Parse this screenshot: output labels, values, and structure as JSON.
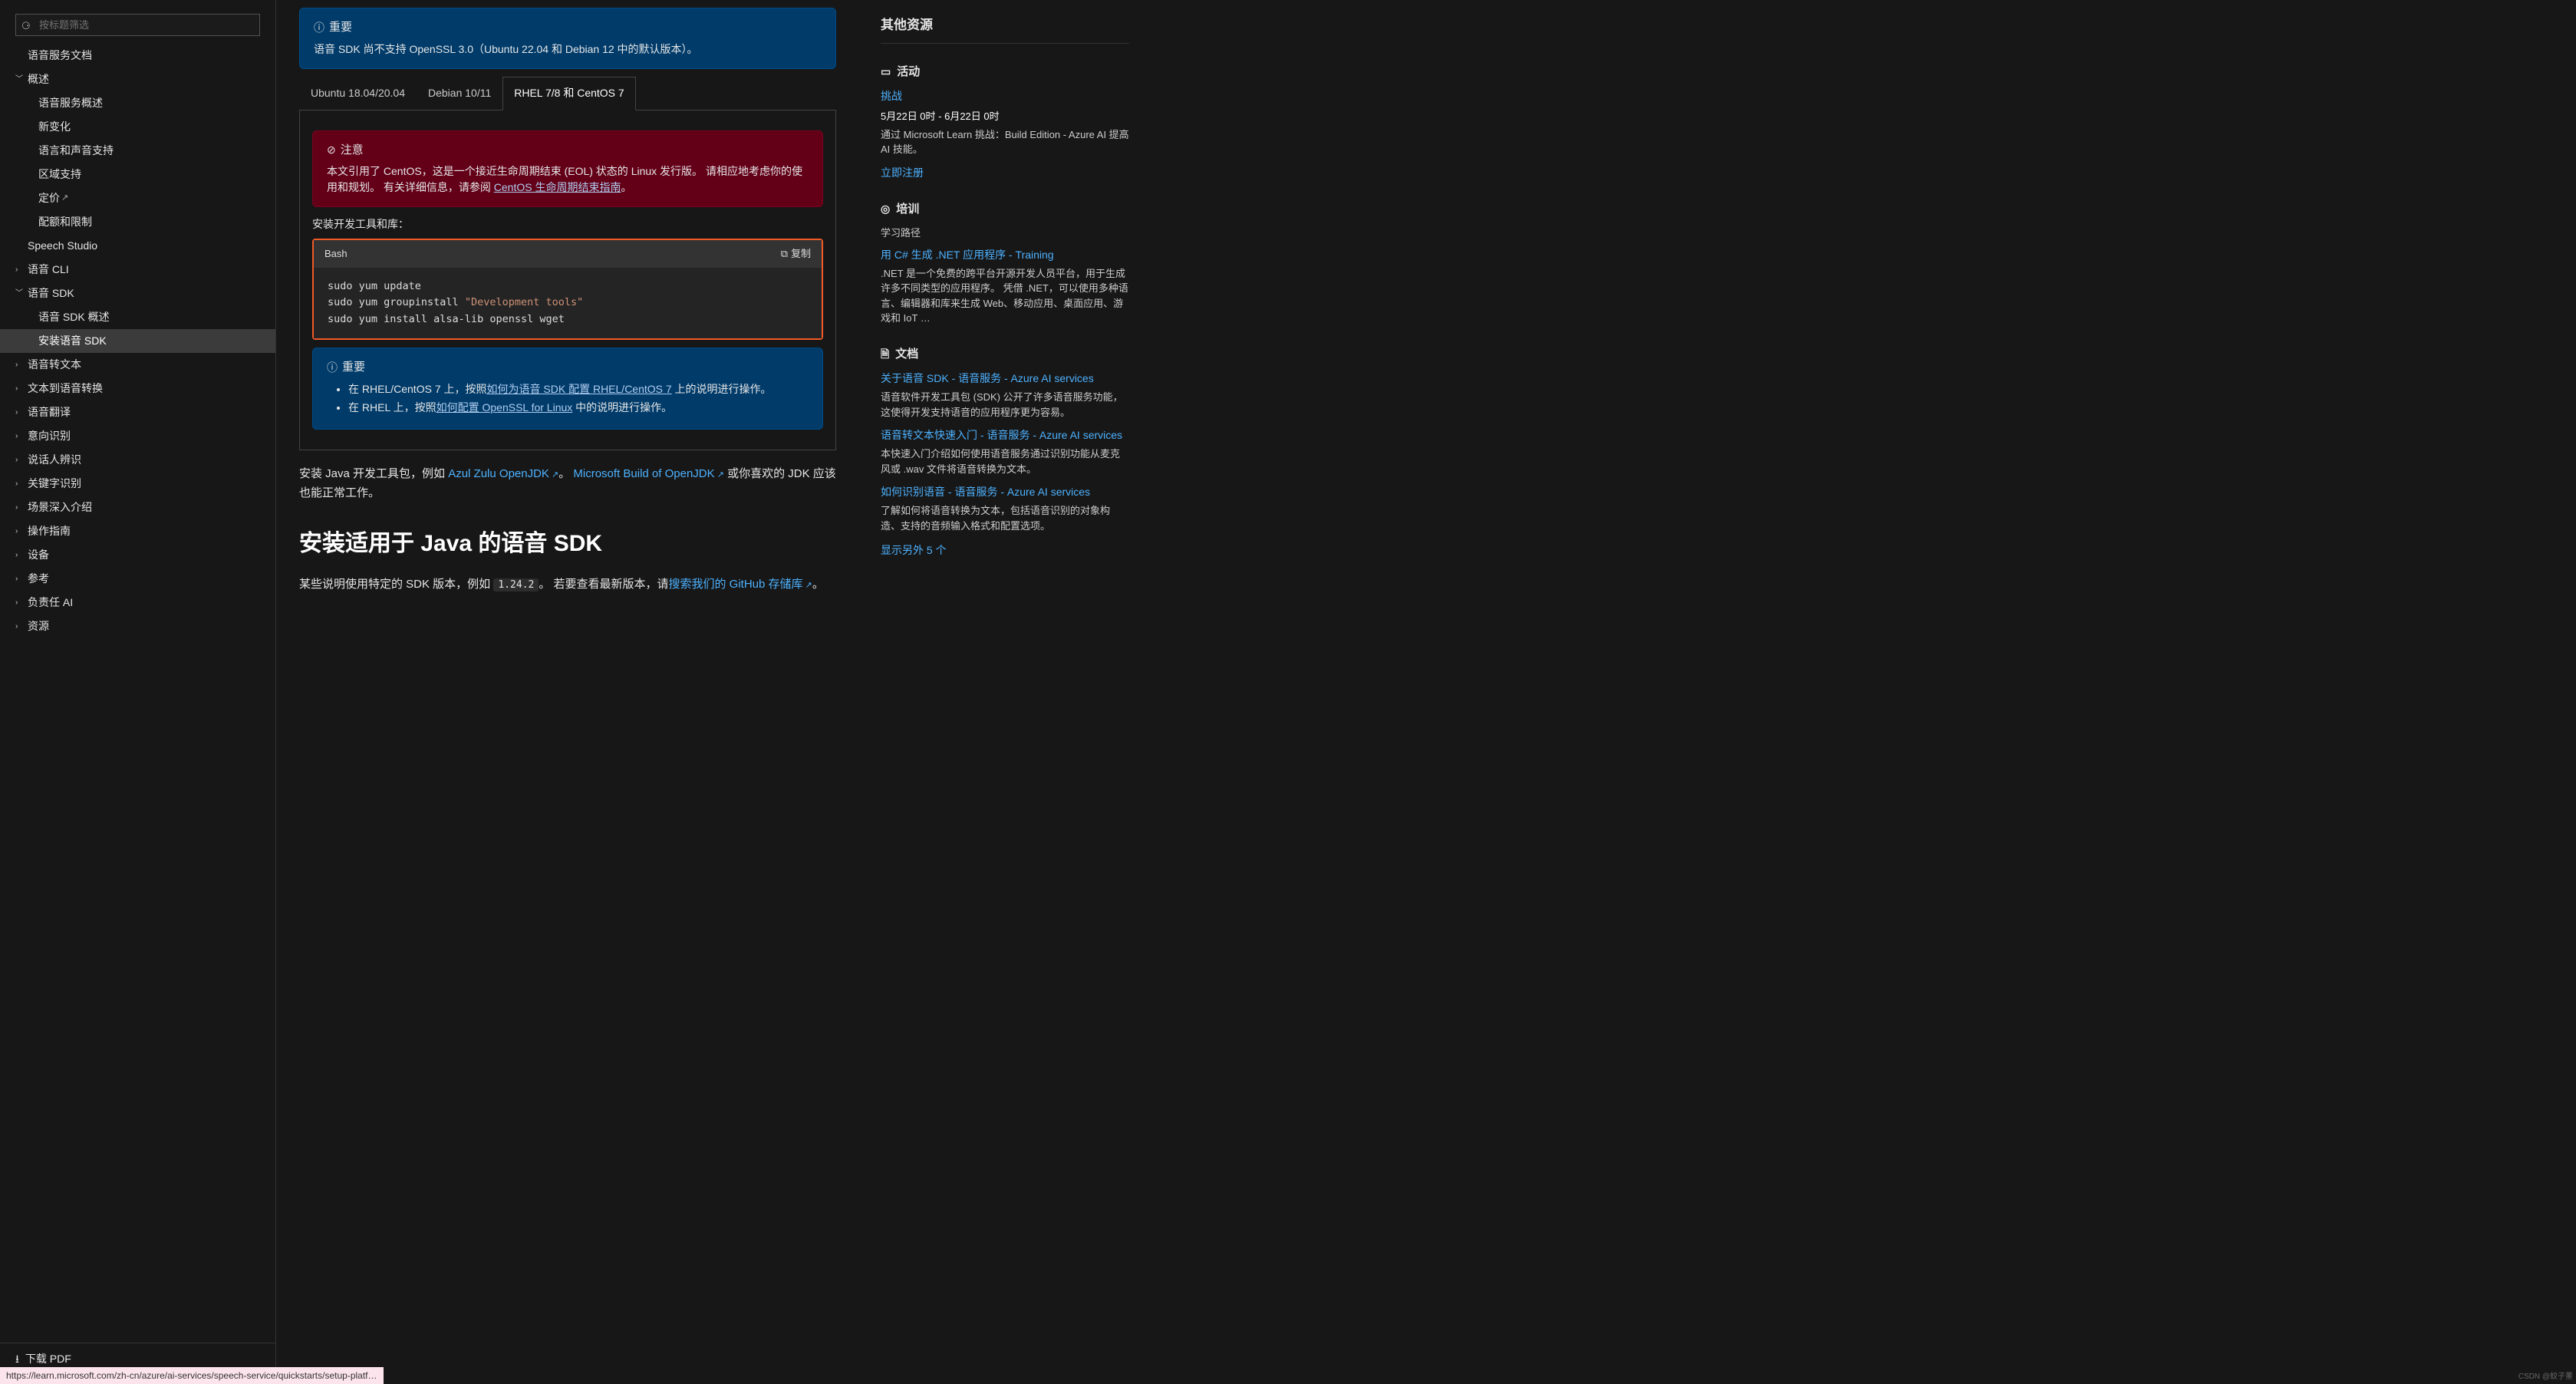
{
  "sidebar": {
    "filter_placeholder": "按标题筛选",
    "items": [
      {
        "label": "语音服务文档",
        "level": 1,
        "exp": false
      },
      {
        "label": "概述",
        "level": 0,
        "exp": true,
        "open": true
      },
      {
        "label": "语音服务概述",
        "level": 2
      },
      {
        "label": "新变化",
        "level": 2
      },
      {
        "label": "语言和声音支持",
        "level": 2
      },
      {
        "label": "区域支持",
        "level": 2
      },
      {
        "label": "定价",
        "level": 2,
        "ext": true
      },
      {
        "label": "配额和限制",
        "level": 2
      },
      {
        "label": "Speech Studio",
        "level": 1
      },
      {
        "label": "语音 CLI",
        "level": 0,
        "exp": true,
        "open": false
      },
      {
        "label": "语音 SDK",
        "level": 0,
        "exp": true,
        "open": true
      },
      {
        "label": "语音 SDK 概述",
        "level": 2
      },
      {
        "label": "安装语音 SDK",
        "level": 2,
        "active": true
      },
      {
        "label": "语音转文本",
        "level": 0,
        "exp": true,
        "open": false
      },
      {
        "label": "文本到语音转换",
        "level": 0,
        "exp": true,
        "open": false
      },
      {
        "label": "语音翻译",
        "level": 0,
        "exp": true,
        "open": false
      },
      {
        "label": "意向识别",
        "level": 0,
        "exp": true,
        "open": false
      },
      {
        "label": "说话人辨识",
        "level": 0,
        "exp": true,
        "open": false
      },
      {
        "label": "关键字识别",
        "level": 0,
        "exp": true,
        "open": false
      },
      {
        "label": "场景深入介绍",
        "level": 0,
        "exp": true,
        "open": false
      },
      {
        "label": "操作指南",
        "level": 0,
        "exp": true,
        "open": false
      },
      {
        "label": "设备",
        "level": 0,
        "exp": true,
        "open": false
      },
      {
        "label": "参考",
        "level": 0,
        "exp": true,
        "open": false
      },
      {
        "label": "负责任 AI",
        "level": 0,
        "exp": true,
        "open": false
      },
      {
        "label": "资源",
        "level": 0,
        "exp": true,
        "open": false
      }
    ],
    "download_pdf": "下载 PDF"
  },
  "main": {
    "important_label": "重要",
    "note_label": "注意",
    "openssl_note": "语音 SDK 尚不支持 OpenSSL 3.0（Ubuntu 22.04 和 Debian 12 中的默认版本）。",
    "tabs": [
      "Ubuntu 18.04/20.04",
      "Debian 10/11",
      "RHEL 7/8 和 CentOS 7"
    ],
    "active_tab": 2,
    "centos_note_pre": "本文引用了 CentOS，这是一个接近生命周期结束 (EOL) 状态的 Linux 发行版。 请相应地考虑你的使用和规划。 有关详细信息，请参阅 ",
    "centos_link": "CentOS 生命周期结束指南",
    "centos_note_post": "。",
    "dev_tools_label": "安装开发工具和库：",
    "code_lang": "Bash",
    "copy_label": "复制",
    "code_line1": "sudo yum update",
    "code_line2a": "sudo yum groupinstall ",
    "code_line2b": "\"Development tools\"",
    "code_line3": "sudo yum install alsa-lib openssl wget",
    "imp2_bullet1_pre": "在 RHEL/CentOS 7 上，按照",
    "imp2_bullet1_link": "如何为语音 SDK 配置 RHEL/CentOS 7",
    "imp2_bullet1_post": " 上的说明进行操作。",
    "imp2_bullet2_pre": "在 RHEL 上，按照",
    "imp2_bullet2_link": "如何配置 OpenSSL for Linux",
    "imp2_bullet2_post": " 中的说明进行操作。",
    "jdk_para_pre": "安装 Java 开发工具包，例如 ",
    "jdk_link1": "Azul Zulu OpenJDK",
    "jdk_sep": "。 ",
    "jdk_link2": "Microsoft Build of OpenJDK",
    "jdk_para_post": " 或你喜欢的 JDK 应该也能正常工作。",
    "h2": "安装适用于 Java 的语音 SDK",
    "sdk_para_pre": "某些说明使用特定的 SDK 版本，例如 ",
    "sdk_ver": "1.24.2",
    "sdk_para_mid": "。 若要查看最新版本，请",
    "sdk_link": "搜索我们的 GitHub 存储库",
    "sdk_para_post": "。"
  },
  "right": {
    "title": "其他资源",
    "activity_h": "活动",
    "challenge": "挑战",
    "date_range": "5月22日 0时 - 6月22日 0时",
    "challenge_desc": "通过 Microsoft Learn 挑战：Build Edition - Azure AI 提高 AI 技能。",
    "register": "立即注册",
    "train_h": "培训",
    "learn_path": "学习路径",
    "train_link": "用 C# 生成 .NET 应用程序 - Training",
    "train_desc": ".NET 是一个免费的跨平台开源开发人员平台，用于生成许多不同类型的应用程序。 凭借 .NET，可以使用多种语言、编辑器和库来生成 Web、移动应用、桌面应用、游戏和 IoT …",
    "docs_h": "文档",
    "doc1_link": "关于语音 SDK - 语音服务 - Azure AI services",
    "doc1_desc": "语音软件开发工具包 (SDK) 公开了许多语音服务功能，这使得开发支持语音的应用程序更为容易。",
    "doc2_link": "语音转文本快速入门 - 语音服务 - Azure AI services",
    "doc2_desc": "本快速入门介绍如何使用语音服务通过识别功能从麦克风或 .wav 文件将语音转换为文本。",
    "doc3_link": "如何识别语音 - 语音服务 - Azure AI services",
    "doc3_desc": "了解如何将语音转换为文本，包括语音识别的对象构造、支持的音频输入格式和配置选项。",
    "show_more": "显示另外 5 个"
  },
  "status_url": "https://learn.microsoft.com/zh-cn/azure/ai-services/speech-service/quickstarts/setup-platform…",
  "watermark": "CSDN @蚊子董"
}
